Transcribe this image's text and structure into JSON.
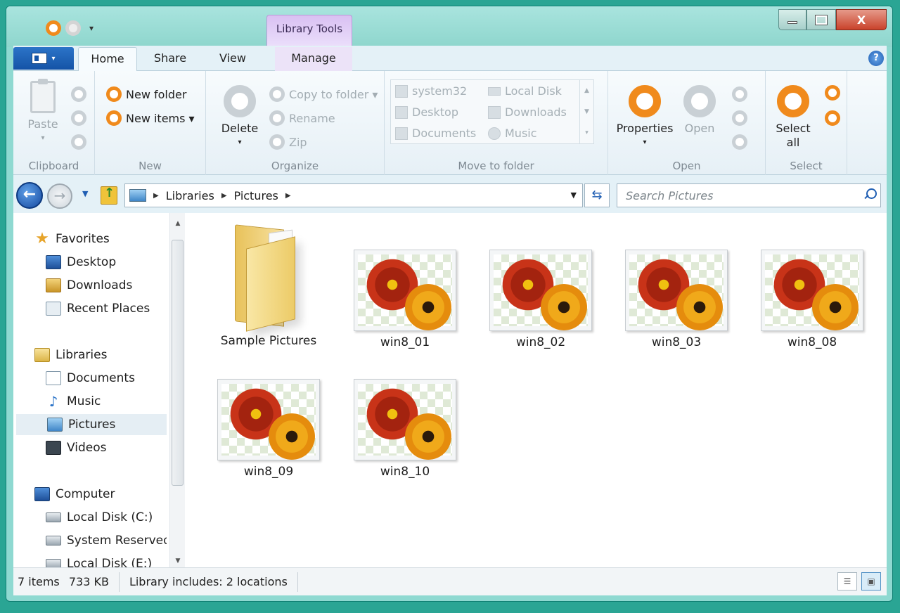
{
  "titlebar": {
    "context_tab": "Library Tools",
    "close_glyph": "X"
  },
  "tabs": {
    "file_caret": "▾",
    "items": [
      "Home",
      "Share",
      "View",
      "Manage"
    ],
    "help_glyph": "?"
  },
  "ribbon": {
    "clipboard": {
      "label": "Clipboard",
      "paste": "Paste"
    },
    "new": {
      "label": "New",
      "new_folder": "New folder",
      "new_items": "New items ▾"
    },
    "organize": {
      "label": "Organize",
      "delete": "Delete",
      "copy_to": "Copy to folder ▾",
      "rename": "Rename",
      "zip": "Zip"
    },
    "move": {
      "label": "Move to folder",
      "items": [
        "system32",
        "Local Disk",
        "Desktop",
        "Downloads",
        "Documents",
        "Music"
      ]
    },
    "open": {
      "label": "Open",
      "properties": "Properties",
      "open": "Open"
    },
    "select": {
      "label": "Select",
      "select_all_line1": "Select",
      "select_all_line2": "all"
    }
  },
  "address": {
    "crumbs": [
      "Libraries",
      "Pictures"
    ],
    "search_placeholder": "Search Pictures"
  },
  "nav": {
    "favorites": "Favorites",
    "desktop": "Desktop",
    "downloads": "Downloads",
    "recent": "Recent Places",
    "libraries": "Libraries",
    "documents": "Documents",
    "music": "Music",
    "pictures": "Pictures",
    "videos": "Videos",
    "computer": "Computer",
    "disk_c": "Local Disk (C:)",
    "system_reserved": "System Reserved",
    "disk_e": "Local Disk (E:)"
  },
  "files": [
    {
      "name": "Sample Pictures",
      "type": "folder"
    },
    {
      "name": "win8_01",
      "type": "image"
    },
    {
      "name": "win8_02",
      "type": "image"
    },
    {
      "name": "win8_03",
      "type": "image"
    },
    {
      "name": "win8_08",
      "type": "image"
    },
    {
      "name": "win8_09",
      "type": "image"
    },
    {
      "name": "win8_10",
      "type": "image"
    }
  ],
  "status": {
    "count": "7 items",
    "size": "733 KB",
    "library": "Library includes:  2 locations"
  },
  "colors": {
    "accent": "#f08a1c",
    "desktop_bg": "#2aa594",
    "file_tab": "#1453a6",
    "context_tab": "#d9c0f2"
  }
}
